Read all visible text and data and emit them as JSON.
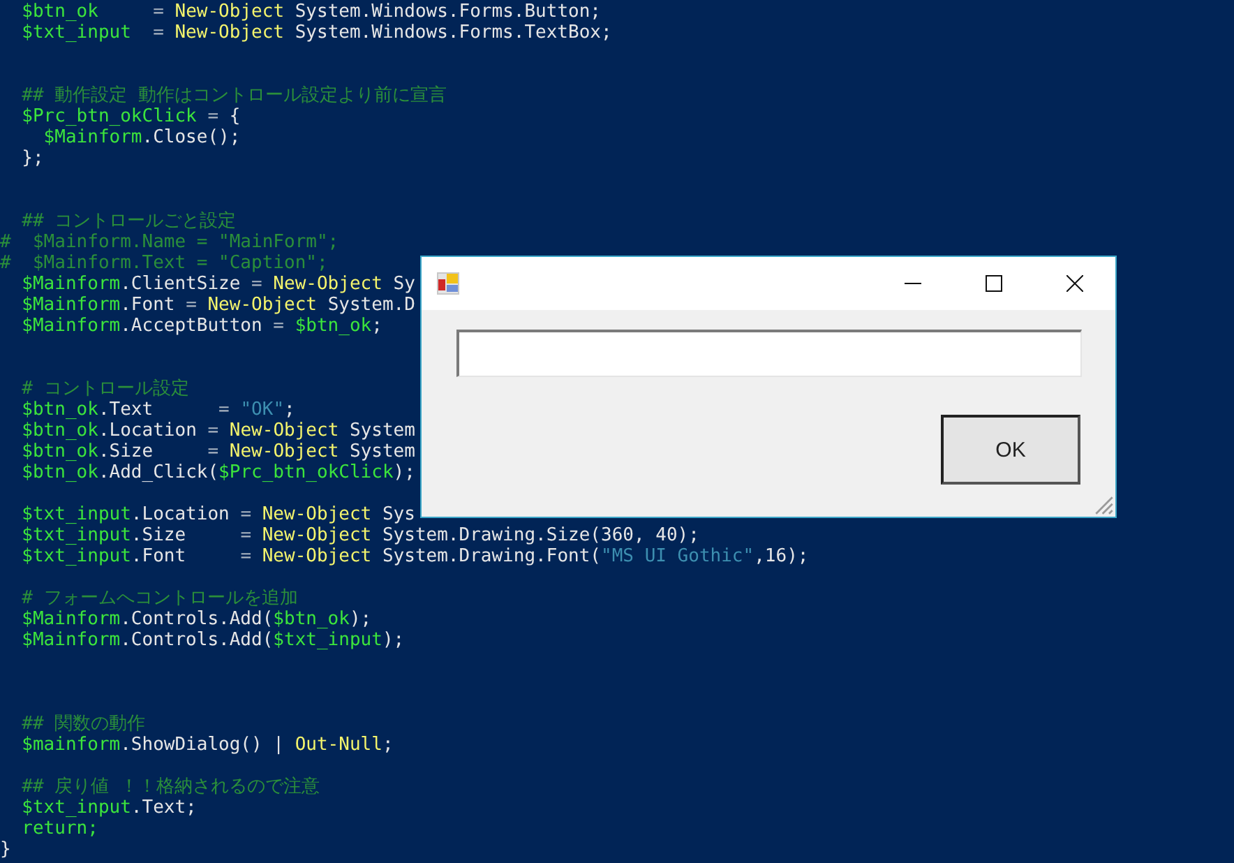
{
  "editor": {
    "lines": [
      {
        "kind": "code",
        "tokens": [
          {
            "kind": "var",
            "text": "  $btn_ok"
          },
          {
            "kind": "op",
            "text": "     = "
          },
          {
            "kind": "keyword",
            "text": "New-Object"
          },
          {
            "kind": "plain",
            "text": " System.Windows.Forms.Button;"
          }
        ]
      },
      {
        "kind": "code",
        "tokens": [
          {
            "kind": "var",
            "text": "  $txt_input"
          },
          {
            "kind": "op",
            "text": "  = "
          },
          {
            "kind": "keyword",
            "text": "New-Object"
          },
          {
            "kind": "plain",
            "text": " System.Windows.Forms.TextBox;"
          }
        ]
      },
      {
        "kind": "blank"
      },
      {
        "kind": "blank"
      },
      {
        "kind": "code",
        "tokens": [
          {
            "kind": "comment",
            "text": "  ## 動作設定 動作はコントロール設定より前に宣言"
          }
        ]
      },
      {
        "kind": "code",
        "tokens": [
          {
            "kind": "var",
            "text": "  $Prc_btn_okClick"
          },
          {
            "kind": "op",
            "text": " = "
          },
          {
            "kind": "plain",
            "text": "{"
          }
        ]
      },
      {
        "kind": "code",
        "tokens": [
          {
            "kind": "var",
            "text": "    $Mainform"
          },
          {
            "kind": "plain",
            "text": ".Close();"
          }
        ]
      },
      {
        "kind": "code",
        "tokens": [
          {
            "kind": "plain",
            "text": "  };"
          }
        ]
      },
      {
        "kind": "blank"
      },
      {
        "kind": "blank"
      },
      {
        "kind": "code",
        "tokens": [
          {
            "kind": "comment",
            "text": "  ## コントロールごと設定"
          }
        ]
      },
      {
        "kind": "code",
        "tokens": [
          {
            "kind": "comment",
            "text": "#  $Mainform.Name = \"MainForm\";"
          }
        ]
      },
      {
        "kind": "code",
        "tokens": [
          {
            "kind": "comment",
            "text": "#  $Mainform.Text = \"Caption\";"
          }
        ]
      },
      {
        "kind": "code",
        "tokens": [
          {
            "kind": "var",
            "text": "  $Mainform"
          },
          {
            "kind": "plain",
            "text": ".ClientSize "
          },
          {
            "kind": "op",
            "text": "= "
          },
          {
            "kind": "keyword",
            "text": "New-Object"
          },
          {
            "kind": "plain",
            "text": " Sy"
          }
        ]
      },
      {
        "kind": "code",
        "tokens": [
          {
            "kind": "var",
            "text": "  $Mainform"
          },
          {
            "kind": "plain",
            "text": ".Font "
          },
          {
            "kind": "op",
            "text": "= "
          },
          {
            "kind": "keyword",
            "text": "New-Object"
          },
          {
            "kind": "plain",
            "text": " System.D"
          }
        ]
      },
      {
        "kind": "code",
        "tokens": [
          {
            "kind": "var",
            "text": "  $Mainform"
          },
          {
            "kind": "plain",
            "text": ".AcceptButton "
          },
          {
            "kind": "op",
            "text": "= "
          },
          {
            "kind": "var",
            "text": "$btn_ok"
          },
          {
            "kind": "plain",
            "text": ";"
          }
        ]
      },
      {
        "kind": "blank"
      },
      {
        "kind": "blank"
      },
      {
        "kind": "code",
        "tokens": [
          {
            "kind": "comment",
            "text": "  # コントロール設定"
          }
        ]
      },
      {
        "kind": "code",
        "tokens": [
          {
            "kind": "var",
            "text": "  $btn_ok"
          },
          {
            "kind": "plain",
            "text": ".Text     "
          },
          {
            "kind": "op",
            "text": " = "
          },
          {
            "kind": "string",
            "text": "\"OK\""
          },
          {
            "kind": "plain",
            "text": ";"
          }
        ]
      },
      {
        "kind": "code",
        "tokens": [
          {
            "kind": "var",
            "text": "  $btn_ok"
          },
          {
            "kind": "plain",
            "text": ".Location "
          },
          {
            "kind": "op",
            "text": "= "
          },
          {
            "kind": "keyword",
            "text": "New-Object"
          },
          {
            "kind": "plain",
            "text": " System"
          }
        ]
      },
      {
        "kind": "code",
        "tokens": [
          {
            "kind": "var",
            "text": "  $btn_ok"
          },
          {
            "kind": "plain",
            "text": ".Size     "
          },
          {
            "kind": "op",
            "text": "= "
          },
          {
            "kind": "keyword",
            "text": "New-Object"
          },
          {
            "kind": "plain",
            "text": " System"
          }
        ]
      },
      {
        "kind": "code",
        "tokens": [
          {
            "kind": "var",
            "text": "  $btn_ok"
          },
          {
            "kind": "plain",
            "text": ".Add_Click("
          },
          {
            "kind": "var",
            "text": "$Prc_btn_okClick"
          },
          {
            "kind": "plain",
            "text": ");"
          }
        ]
      },
      {
        "kind": "blank"
      },
      {
        "kind": "code",
        "tokens": [
          {
            "kind": "var",
            "text": "  $txt_input"
          },
          {
            "kind": "plain",
            "text": ".Location "
          },
          {
            "kind": "op",
            "text": "= "
          },
          {
            "kind": "keyword",
            "text": "New-Object"
          },
          {
            "kind": "plain",
            "text": " Sys"
          }
        ]
      },
      {
        "kind": "code",
        "tokens": [
          {
            "kind": "var",
            "text": "  $txt_input"
          },
          {
            "kind": "plain",
            "text": ".Size     "
          },
          {
            "kind": "op",
            "text": "= "
          },
          {
            "kind": "keyword",
            "text": "New-Object"
          },
          {
            "kind": "plain",
            "text": " System.Drawing.Size(360, 40);"
          }
        ]
      },
      {
        "kind": "code",
        "tokens": [
          {
            "kind": "var",
            "text": "  $txt_input"
          },
          {
            "kind": "plain",
            "text": ".Font     "
          },
          {
            "kind": "op",
            "text": "= "
          },
          {
            "kind": "keyword",
            "text": "New-Object"
          },
          {
            "kind": "plain",
            "text": " System.Drawing.Font("
          },
          {
            "kind": "string",
            "text": "\"MS UI Gothic\""
          },
          {
            "kind": "plain",
            "text": ",16);"
          }
        ]
      },
      {
        "kind": "blank"
      },
      {
        "kind": "code",
        "tokens": [
          {
            "kind": "comment",
            "text": "  # フォームへコントロールを追加"
          }
        ]
      },
      {
        "kind": "code",
        "tokens": [
          {
            "kind": "var",
            "text": "  $Mainform"
          },
          {
            "kind": "plain",
            "text": ".Controls.Add("
          },
          {
            "kind": "var",
            "text": "$btn_ok"
          },
          {
            "kind": "plain",
            "text": ");"
          }
        ]
      },
      {
        "kind": "code",
        "tokens": [
          {
            "kind": "var",
            "text": "  $Mainform"
          },
          {
            "kind": "plain",
            "text": ".Controls.Add("
          },
          {
            "kind": "var",
            "text": "$txt_input"
          },
          {
            "kind": "plain",
            "text": ");"
          }
        ]
      },
      {
        "kind": "blank"
      },
      {
        "kind": "blank"
      },
      {
        "kind": "blank"
      },
      {
        "kind": "code",
        "tokens": [
          {
            "kind": "comment",
            "text": "  ## 関数の動作"
          }
        ]
      },
      {
        "kind": "code",
        "tokens": [
          {
            "kind": "var",
            "text": "  $mainform"
          },
          {
            "kind": "plain",
            "text": ".ShowDialog() | "
          },
          {
            "kind": "keyword",
            "text": "Out-Null"
          },
          {
            "kind": "plain",
            "text": ";"
          }
        ]
      },
      {
        "kind": "blank"
      },
      {
        "kind": "code",
        "tokens": [
          {
            "kind": "comment",
            "text": "  ## 戻り値 ！！格納されるので注意"
          }
        ]
      },
      {
        "kind": "code",
        "tokens": [
          {
            "kind": "var",
            "text": "  $txt_input"
          },
          {
            "kind": "plain",
            "text": ".Text;"
          }
        ]
      },
      {
        "kind": "code",
        "tokens": [
          {
            "kind": "var",
            "text": "  return;"
          }
        ]
      },
      {
        "kind": "code",
        "tokens": [
          {
            "kind": "plain",
            "text": "}"
          }
        ]
      }
    ]
  },
  "dialog": {
    "button": "OK"
  }
}
